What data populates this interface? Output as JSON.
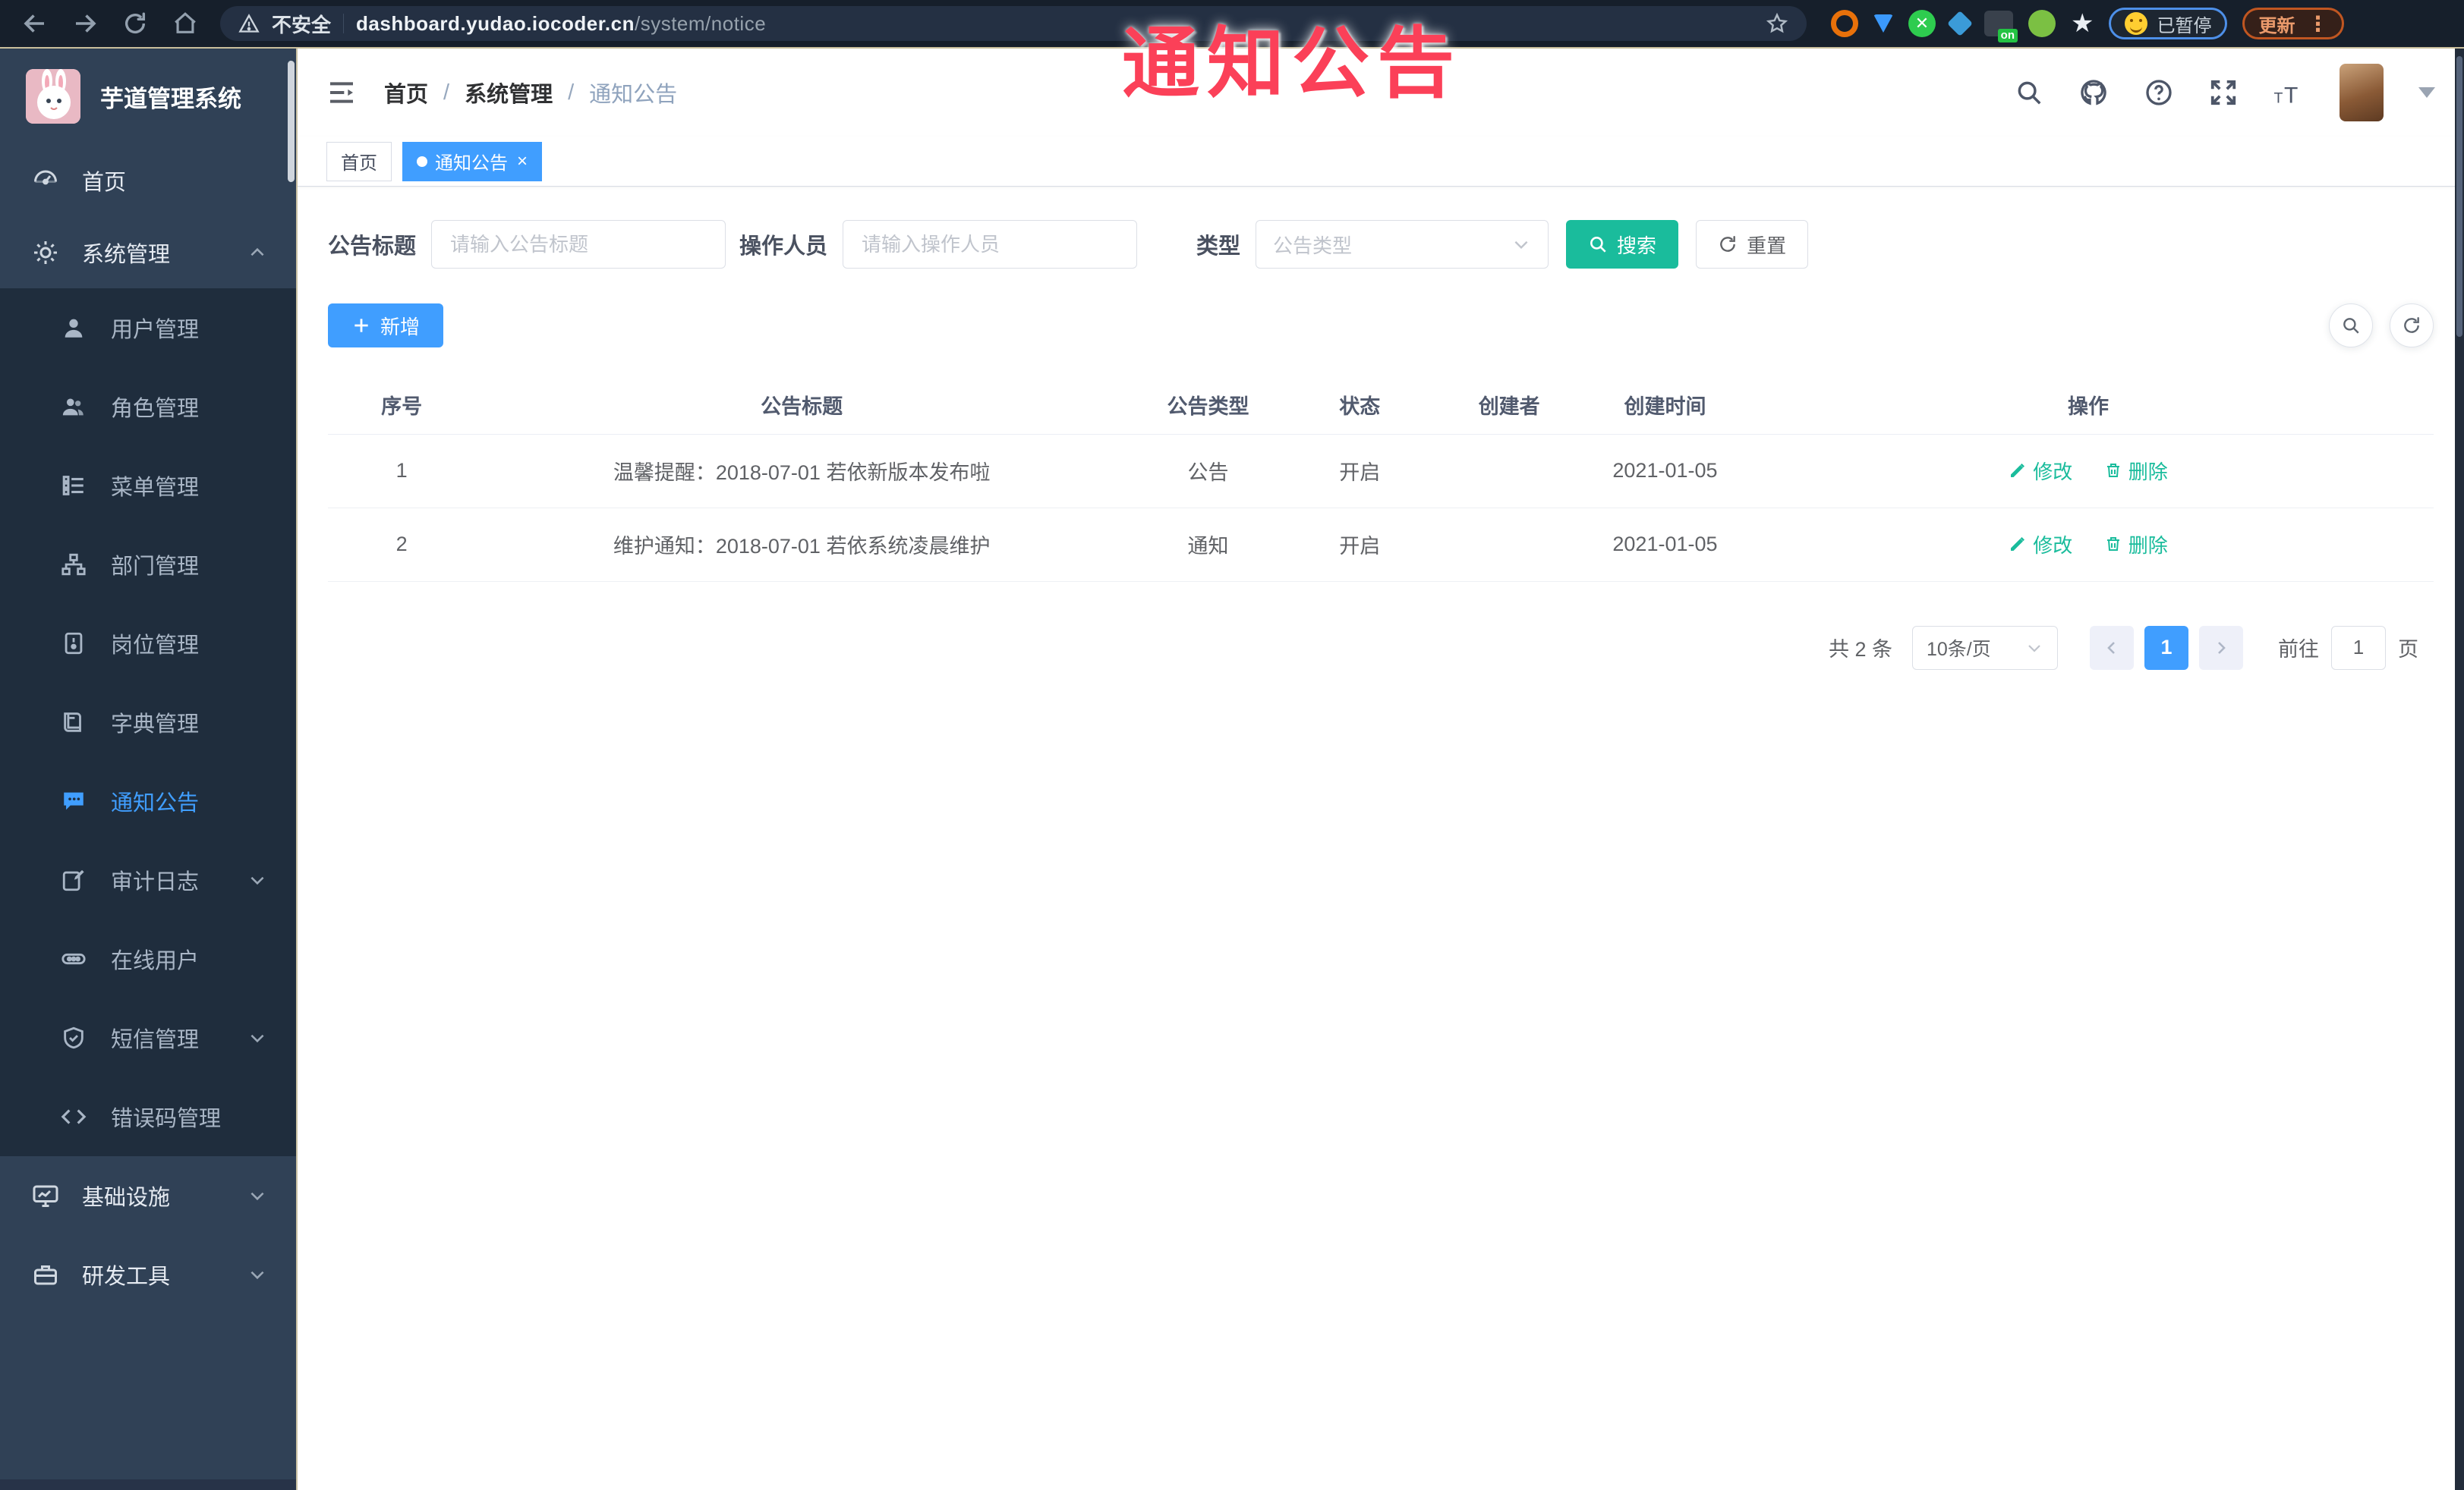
{
  "browser": {
    "security_label": "不安全",
    "url_host": "dashboard.yudao.iocoder.cn",
    "url_path": "/system/notice",
    "on_badge": "on",
    "paused_label": "已暂停",
    "update_label": "更新",
    "ext_check_glyph": "✕"
  },
  "annotation": {
    "text": "通知公告",
    "color": "#fb4058"
  },
  "sidebar": {
    "app_title": "芋道管理系统",
    "items": [
      {
        "label": "首页"
      },
      {
        "label": "系统管理"
      },
      {
        "label": "用户管理"
      },
      {
        "label": "角色管理"
      },
      {
        "label": "菜单管理"
      },
      {
        "label": "部门管理"
      },
      {
        "label": "岗位管理"
      },
      {
        "label": "字典管理"
      },
      {
        "label": "通知公告"
      },
      {
        "label": "审计日志"
      },
      {
        "label": "在线用户"
      },
      {
        "label": "短信管理"
      },
      {
        "label": "错误码管理"
      },
      {
        "label": "基础设施"
      },
      {
        "label": "研发工具"
      }
    ]
  },
  "breadcrumb": {
    "items": [
      "首页",
      "系统管理",
      "通知公告"
    ],
    "separator": "/"
  },
  "tabs": {
    "items": [
      {
        "label": "首页"
      },
      {
        "label": "通知公告"
      }
    ],
    "close_glyph": "×"
  },
  "filters": {
    "title_label": "公告标题",
    "title_placeholder": "请输入公告标题",
    "operator_label": "操作人员",
    "operator_placeholder": "请输入操作人员",
    "type_label": "类型",
    "type_placeholder": "公告类型",
    "search_label": "搜索",
    "reset_label": "重置"
  },
  "toolbar": {
    "add_label": "新增"
  },
  "table": {
    "headers": [
      "序号",
      "公告标题",
      "公告类型",
      "状态",
      "创建者",
      "创建时间",
      "操作"
    ],
    "rows": [
      {
        "index": "1",
        "title": "温馨提醒：2018-07-01 若依新版本发布啦",
        "type": "公告",
        "status": "开启",
        "creator": "",
        "created": "2021-01-05"
      },
      {
        "index": "2",
        "title": "维护通知：2018-07-01 若依系统凌晨维护",
        "type": "通知",
        "status": "开启",
        "creator": "",
        "created": "2021-01-05"
      }
    ],
    "edit_label": "修改",
    "delete_label": "删除"
  },
  "pagination": {
    "total_text": "共 2 条",
    "page_size": "10条/页",
    "current_page": "1",
    "goto_label": "前往",
    "goto_value": "1",
    "page_unit": "页"
  },
  "colors": {
    "accent_blue": "#409eff",
    "accent_teal": "#1abc9c",
    "sidebar_bg": "#304156",
    "submenu_bg": "#1f2d3d",
    "browser_bg": "#161f2b",
    "annotation_red": "#fb4058"
  },
  "icons": {
    "back-icon": "←",
    "forward-icon": "→",
    "reload-icon": "⟳",
    "home-icon": "⌂",
    "warning-icon": "⚠",
    "bookmark-star-icon": "☆",
    "search-icon": "🔍",
    "github-icon": "octocat",
    "help-icon": "?",
    "fullscreen-icon": "⛶",
    "font-size-icon": "tT",
    "hamburger-icon": "☰",
    "edit-icon": "✎",
    "delete-icon": "🗑"
  }
}
